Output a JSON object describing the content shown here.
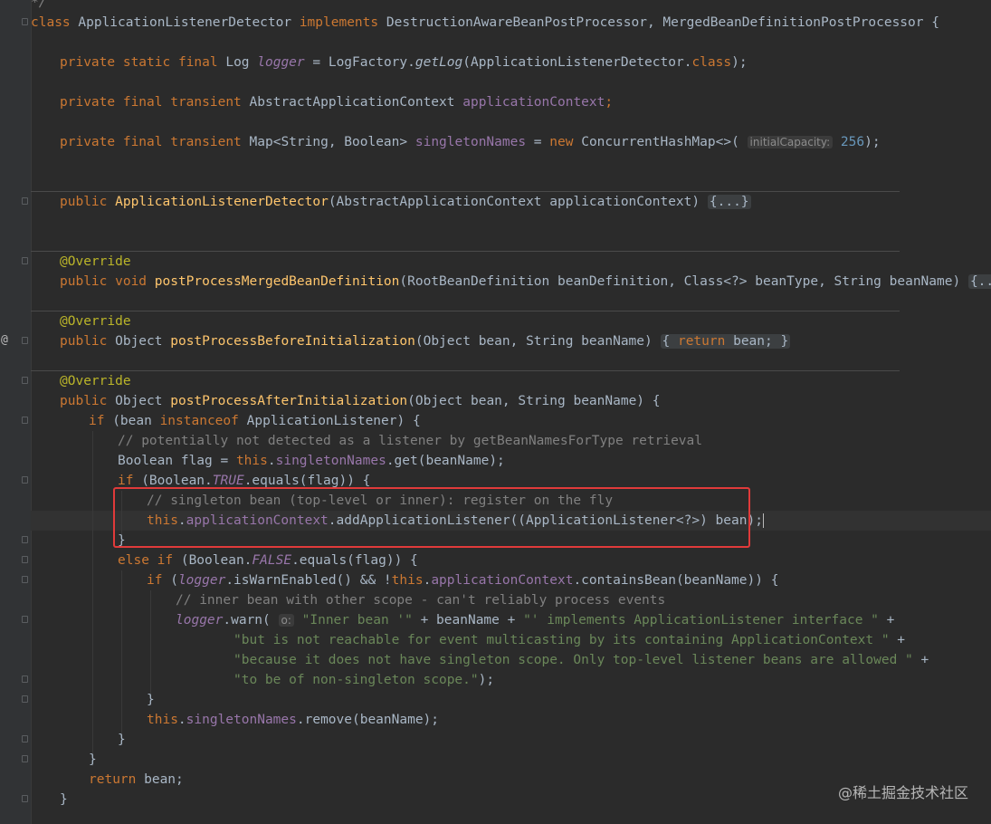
{
  "editor": {
    "line_prev": "*/",
    "class_decl": {
      "kw_class": "class",
      "name": "ApplicationListenerDetector",
      "kw_implements": "implements",
      "interfaces": "DestructionAwareBeanPostProcessor, MergedBeanDefinitionPostProcessor {"
    },
    "logger_line": {
      "mods": "private static final",
      "type": " Log ",
      "name": "logger",
      "rest1": " = LogFactory.",
      "method": "getLog",
      "rest2": "(ApplicationListenerDetector.",
      "kw": "class",
      "end": ");"
    },
    "ctx_field": {
      "mods": "private final transient",
      "type": " AbstractApplicationContext ",
      "name": "applicationContext",
      "end": ";"
    },
    "names_field": {
      "mods": "private final transient",
      "type": " Map<String, Boolean> ",
      "name": "singletonNames",
      "eq": " = ",
      "kw_new": "new",
      "ctor": " ConcurrentHashMap<>(",
      "hint": "initialCapacity:",
      "num": "256",
      "end": ");"
    },
    "ctor_line": {
      "kw": "public",
      "name": "ApplicationListenerDetector",
      "params": "(AbstractApplicationContext applicationContext)",
      "folded": "{...}"
    },
    "override": "@Override",
    "merged_line": {
      "kw": "public void",
      "name": "postProcessMergedBeanDefinition",
      "params": "(RootBeanDefinition beanDefinition, Class<?> beanType, String beanName)",
      "folded": "{...}"
    },
    "before_line": {
      "kw": "public",
      "type": " Object ",
      "name": "postProcessBeforeInitialization",
      "params": "(Object bean, String beanName)",
      "body_open": "{",
      "kw_return": "return",
      "body": " bean;",
      "body_close": "}"
    },
    "after_line": {
      "kw": "public",
      "type": " Object ",
      "name": "postProcessAfterInitialization",
      "params": "(Object bean, String beanName) {"
    },
    "if_line": {
      "kw_if": "if",
      "a": " (bean ",
      "kw_inst": "instanceof",
      "b": " ApplicationListener) {"
    },
    "comment1": "// potentially not detected as a listener by getBeanNamesForType retrieval",
    "flag_line": {
      "a": "Boolean flag = ",
      "kw_this": "this",
      "dot": ".",
      "fld": "singletonNames",
      "b": ".get(beanName);"
    },
    "if_true": {
      "kw_if": "if",
      "a": " (Boolean.",
      "const": "TRUE",
      "b": ".equals(flag)) {"
    },
    "comment2": "// singleton bean (top-level or inner): register on the fly",
    "add_line": {
      "kw_this": "this",
      "dot": ".",
      "fld": "applicationContext",
      "b": ".addApplicationListener((ApplicationListener<?>) bean);"
    },
    "close_brace": "}",
    "else_if": {
      "kw": "else if",
      "a": " (Boolean.",
      "const": "FALSE",
      "b": ".equals(flag)) {"
    },
    "warn_if": {
      "kw_if": "if",
      "a": " (",
      "logger": "logger",
      "b": ".isWarnEnabled() && !",
      "kw_this": "this",
      "dot": ".",
      "fld": "applicationContext",
      "c": ".containsBean(beanName)) {"
    },
    "comment3": "// inner bean with other scope - can't reliably process events",
    "warn_line": {
      "logger": "logger",
      "a": ".warn(",
      "hint": "o:",
      "s1": "\"Inner bean '\"",
      "b": " + beanName + ",
      "s2": "\"' implements ApplicationListener interface \"",
      "c": " +"
    },
    "warn2": {
      "s": "\"but is not reachable for event multicasting by its containing ApplicationContext \"",
      "c": " +"
    },
    "warn3": {
      "s": "\"because it does not have singleton scope. Only top-level listener beans are allowed \"",
      "c": " +"
    },
    "warn4": {
      "s": "\"to be of non-singleton scope.\"",
      "c": ");"
    },
    "remove_line": {
      "kw_this": "this",
      "dot": ".",
      "fld": "singletonNames",
      "b": ".remove(beanName);"
    },
    "return_line": {
      "kw": "return",
      "b": " bean;"
    },
    "gutter_marker": "@"
  },
  "watermark": "@稀土掘金技术社区",
  "colors": {
    "background": "#2b2b2b",
    "keyword": "#cc7832",
    "method": "#ffc66d",
    "field": "#9876aa",
    "string": "#6a8759",
    "comment": "#808080",
    "number": "#6897bb",
    "annotation": "#bbb529",
    "highlight_box": "#e03a3a"
  }
}
